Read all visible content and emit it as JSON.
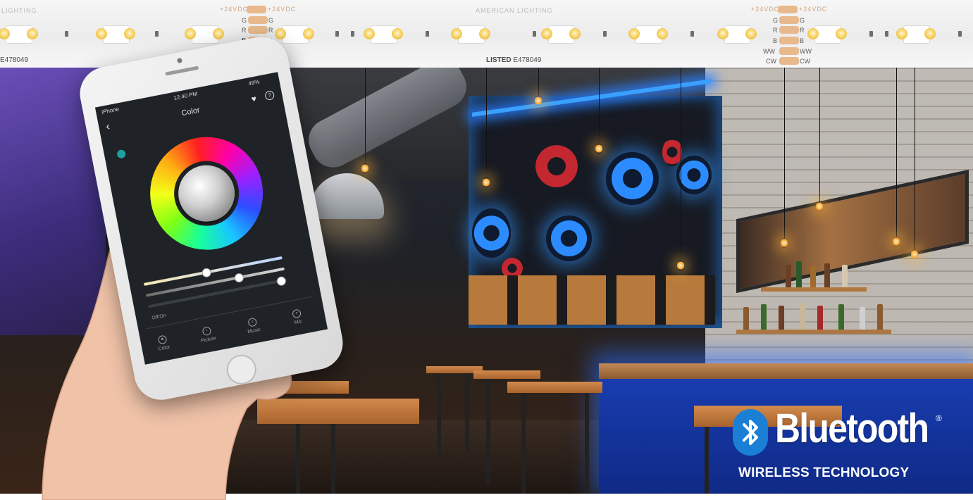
{
  "strip": {
    "brand_left": "LIGHTING",
    "brand_center": "AMERICAN LIGHTING",
    "voltage_left": "+24VDC",
    "voltage_right": "+24VDC",
    "pins_a": [
      "G",
      "R",
      "B"
    ],
    "pins_b": [
      "G",
      "R",
      "B",
      "WW",
      "CW"
    ],
    "pins_c_left": [
      "WW",
      "CW"
    ],
    "listing_left": "E478049",
    "listing_mark": "LISTED",
    "listing_number": "E478049"
  },
  "phone": {
    "status_carrier": "iPhone",
    "status_time": "12:40 PM",
    "status_battery": "49%",
    "app_title": "Color",
    "label_offon": "Off/On",
    "tabs": [
      "Color",
      "Picture",
      "Music",
      "Mic"
    ]
  },
  "bluetooth": {
    "wordmark": "Bluetooth",
    "registered": "®",
    "tagline": "WIRELESS TECHNOLOGY",
    "logo_color": "#1b7fd6"
  }
}
